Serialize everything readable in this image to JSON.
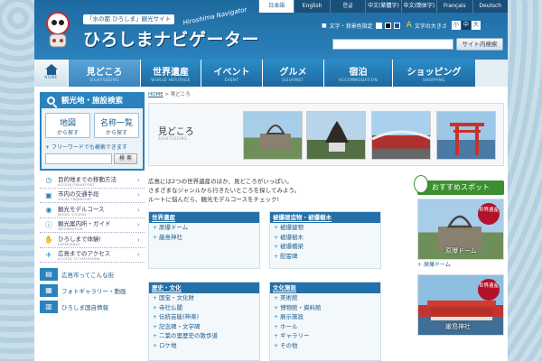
{
  "header": {
    "tagline": "「水の都 ひろしま」観光サイト",
    "site_name": "ひろしまナビゲーター",
    "site_name_en": "Hiroshima Navigator",
    "languages": [
      "日本語",
      "English",
      "한글",
      "中文(繁體字)",
      "中文(簡体字)",
      "Français",
      "Deutsch"
    ],
    "active_language": "日本語",
    "color_setting_label": "文字・背景色指定",
    "font_size_label": "文字の大きさ",
    "font_sizes": [
      "小",
      "中",
      "大"
    ],
    "search_button": "サイト内検索",
    "search_placeholder": ""
  },
  "nav": {
    "home": {
      "en": "HOME"
    },
    "items": [
      {
        "jp": "見どころ",
        "en": "SIGHTSEEING"
      },
      {
        "jp": "世界遺産",
        "en": "WORLD HERITAGE"
      },
      {
        "jp": "イベント",
        "en": "EVENT"
      },
      {
        "jp": "グルメ",
        "en": "GOURMET"
      },
      {
        "jp": "宿泊",
        "en": "ACCOMMODATION"
      },
      {
        "jp": "ショッピング",
        "en": "SHOPPING"
      }
    ],
    "active": "見どころ"
  },
  "sidebar": {
    "search_title": "観光地・施設検索",
    "btn_area": {
      "main": "地図",
      "sub": "から探す"
    },
    "btn_name": {
      "main": "名称一覧",
      "sub": "から探す"
    },
    "free_word_label": "+ フリーワードでも検索できます",
    "free_search_button": "検 索",
    "menu": [
      {
        "label": "目的地までの移動方法",
        "en": "ACCESS/TRANSPORT"
      },
      {
        "label": "市内の交通手段",
        "en": "LOCAL TRANSPORT"
      },
      {
        "label": "観光モデルコース",
        "en": "MODEL COURSE"
      },
      {
        "label": "観光案内所・ガイド",
        "en": "INFORMATION"
      },
      {
        "label": "ひろしまで体験!",
        "en": "EXPERIENCE"
      },
      {
        "label": "広島までのアクセス",
        "en": "ACCESS TO HIROSHIMA"
      }
    ],
    "links": [
      "広島市ってこんな街",
      "フォトギャラリー・動画",
      "ひろしま国自情報"
    ]
  },
  "main": {
    "breadcrumb_home": "HOME",
    "breadcrumb_sep": " > ",
    "breadcrumb_current": "見どころ",
    "hero_title": "見どころ",
    "hero_sub": "SIGHTSEEING",
    "intro": [
      "広島には2つの世界遺産のほか、見どころがいっぱい。",
      "さまざまなジャンルから行きたいところを探してみよう。",
      "ルートに悩んだら、観光モデルコースをチェック!"
    ],
    "categories": [
      {
        "title": "世界遺産",
        "items": [
          "原爆ドーム",
          "厳島神社"
        ]
      },
      {
        "title": "被爆建造物・被爆樹木",
        "items": [
          "被爆建物",
          "被爆樹木",
          "被爆橋梁",
          "慰霊碑"
        ]
      },
      {
        "title": "歴史・文化",
        "items": [
          "国宝・文化財",
          "寺社仏閣",
          "伝統芸能(神楽)",
          "記念碑・文学碑",
          "二葉の里歴史の散歩道",
          "ロケ地"
        ]
      },
      {
        "title": "文化施設",
        "items": [
          "美術館",
          "博物館・資料館",
          "展示施設",
          "ホール",
          "ギャラリー",
          "その他"
        ]
      }
    ]
  },
  "recommend": {
    "title": "おすすめスポット",
    "spots": [
      {
        "caption": "原爆ドーム",
        "badge": "世界遺産",
        "link": "原爆ドーム"
      },
      {
        "caption": "厳島神社",
        "badge": "世界遺産"
      }
    ]
  },
  "colors": {
    "primary": "#2b82bd",
    "header": "#1e6aa0",
    "recommend": "#3b8f2f",
    "badge": "#b3122a"
  }
}
